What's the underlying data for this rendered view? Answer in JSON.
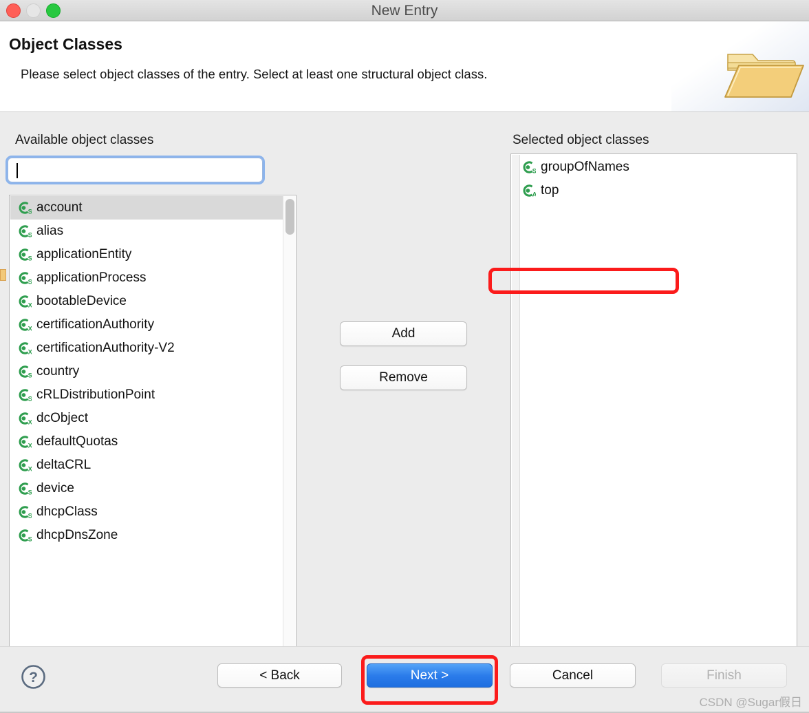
{
  "window": {
    "title": "New Entry",
    "traffic_lights": [
      "close-button",
      "minimize-button",
      "maximize-button"
    ]
  },
  "header": {
    "title": "Object Classes",
    "description": "Please select object classes of the entry. Select at least one structural object class.",
    "banner_icon": "open-folder-icon"
  },
  "available_panel": {
    "label": "Available object classes",
    "search": {
      "value": "",
      "placeholder": "",
      "focused": true
    },
    "refresh_button": {
      "icon": "refresh-arrows-icon",
      "label": ""
    },
    "items": [
      {
        "name": "account",
        "kind": "S",
        "selected": true
      },
      {
        "name": "alias",
        "kind": "S",
        "selected": false
      },
      {
        "name": "applicationEntity",
        "kind": "S",
        "selected": false
      },
      {
        "name": "applicationProcess",
        "kind": "S",
        "selected": false
      },
      {
        "name": "bootableDevice",
        "kind": "X",
        "selected": false
      },
      {
        "name": "certificationAuthority",
        "kind": "X",
        "selected": false
      },
      {
        "name": "certificationAuthority-V2",
        "kind": "X",
        "selected": false
      },
      {
        "name": "country",
        "kind": "S",
        "selected": false
      },
      {
        "name": "cRLDistributionPoint",
        "kind": "S",
        "selected": false
      },
      {
        "name": "dcObject",
        "kind": "X",
        "selected": false
      },
      {
        "name": "defaultQuotas",
        "kind": "X",
        "selected": false
      },
      {
        "name": "deltaCRL",
        "kind": "X",
        "selected": false
      },
      {
        "name": "device",
        "kind": "S",
        "selected": false
      },
      {
        "name": "dhcpClass",
        "kind": "S",
        "selected": false
      },
      {
        "name": "dhcpDnsZone",
        "kind": "S",
        "selected": false
      }
    ]
  },
  "transfer_buttons": {
    "add_label": "Add",
    "remove_label": "Remove"
  },
  "selected_panel": {
    "label": "Selected object classes",
    "items": [
      {
        "name": "groupOfNames",
        "kind": "S",
        "highlighted": true
      },
      {
        "name": "top",
        "kind": "A",
        "highlighted": false
      }
    ]
  },
  "footer": {
    "help_icon": "question-mark-icon",
    "back_label": "< Back",
    "next_label": "Next >",
    "cancel_label": "Cancel",
    "finish_label": "Finish",
    "finish_disabled": true,
    "next_is_default": true
  },
  "watermark": "CSDN @Sugar假日",
  "colors": {
    "primary_button": "#2a7bea",
    "annotation_red": "#fb1b1b",
    "icon_green": "#2f9e4f",
    "window_chrome": "#ececec",
    "disabled_text": "#b0b0b0"
  }
}
